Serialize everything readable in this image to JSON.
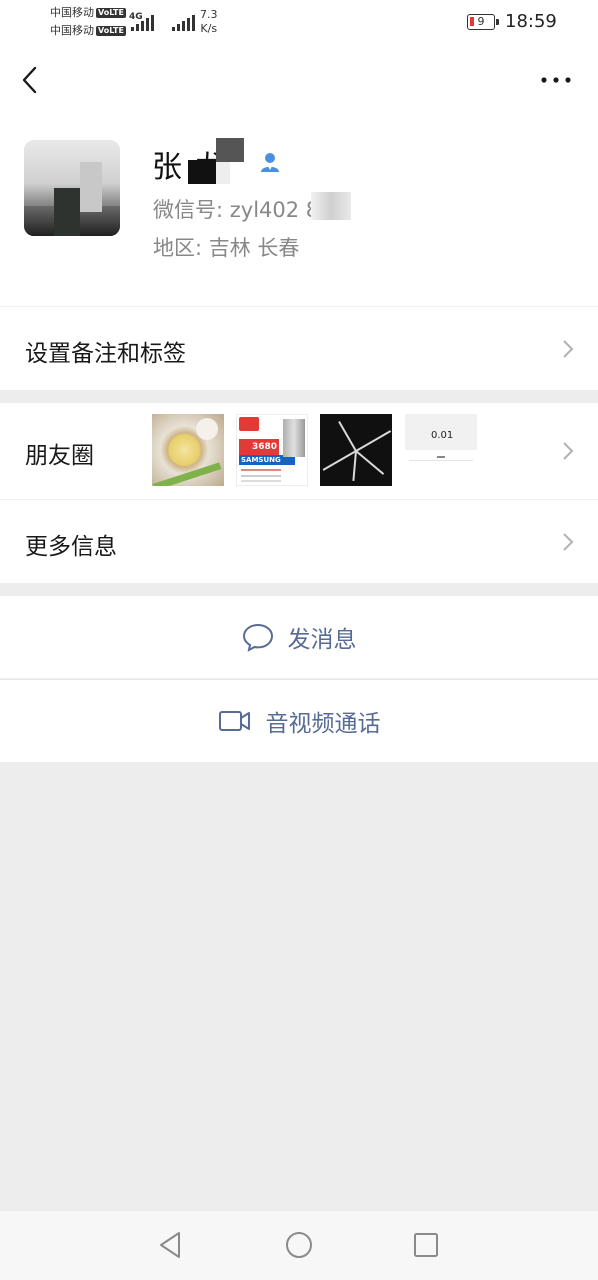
{
  "status_bar": {
    "carrier1": "中国移动",
    "carrier2": "中国移动",
    "volte": "VoLTE",
    "network_type": "4G",
    "speed_value": "7.3",
    "speed_unit": "K/s",
    "battery": "9",
    "time": "18:59"
  },
  "nav": {
    "back_icon": "chevron-left-icon",
    "more_icon": "more-dots-icon"
  },
  "profile": {
    "name": "张  龙",
    "wechat_id": "微信号: zyl402    894",
    "region": "地区: 吉林  长春",
    "verified_icon": "user-badge-icon"
  },
  "rows": {
    "remark_tags": "设置备注和标签",
    "moments": "朋友圈",
    "more_info": "更多信息"
  },
  "moments_thumbs": {
    "t2_price": "3680",
    "t2_brand": "SAMSUNG",
    "t4_amount": "0.01"
  },
  "actions": {
    "send_message": "发消息",
    "av_call": "音视频通话"
  },
  "colors": {
    "link": "#576b95",
    "background": "#ededed",
    "verified": "#4a90e2"
  }
}
